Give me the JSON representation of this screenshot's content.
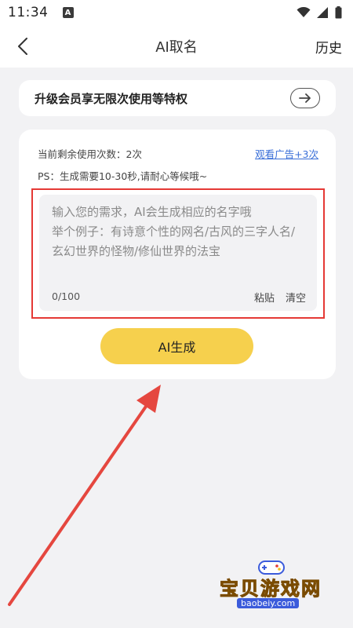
{
  "status_bar": {
    "time": "11:34",
    "notification_letter": "A"
  },
  "nav": {
    "title": "AI取名",
    "history_label": "历史"
  },
  "upgrade": {
    "text": "升级会员享无限次使用等特权"
  },
  "usage": {
    "remaining_text": "当前剩余使用次数：2次",
    "watch_ad_label": "观看广告+3次",
    "ps_text": "PS：生成需要10-30秒,请耐心等候哦~"
  },
  "input": {
    "placeholder": "输入您的需求，AI会生成相应的名字哦\n举个例子：有诗意个性的网名/古风的三字人名/玄幻世界的怪物/修仙世界的法宝",
    "value": "",
    "counter": "0/100",
    "paste_label": "粘贴",
    "clear_label": "清空"
  },
  "generate_button": {
    "label": "AI生成"
  },
  "watermark": {
    "title": "宝贝游戏网",
    "url": "baobeiy.com"
  },
  "colors": {
    "accent_yellow": "#f6d04d",
    "link_blue": "#3a6fd8",
    "annotation_red": "#e53935",
    "page_bg": "#f2f2f4"
  }
}
